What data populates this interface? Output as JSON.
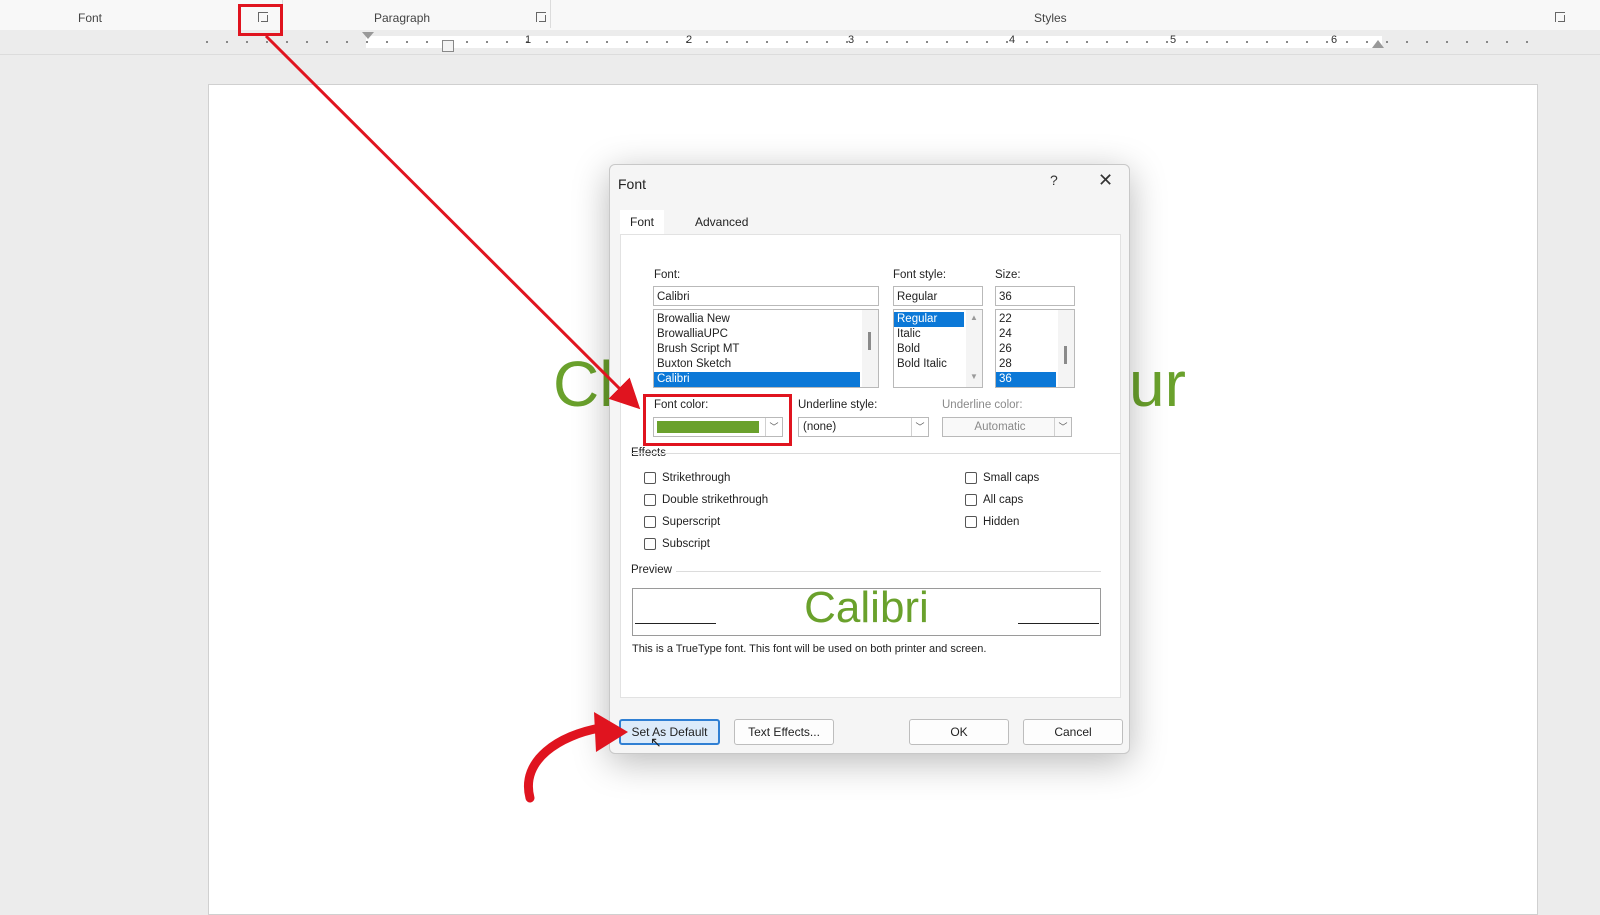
{
  "ribbon": {
    "groups": [
      {
        "label": "Font"
      },
      {
        "label": "Paragraph"
      },
      {
        "label": "Styles"
      }
    ]
  },
  "ruler": {
    "numbers": [
      "1",
      "2",
      "3",
      "4",
      "5",
      "6"
    ]
  },
  "document": {
    "text_left": "Cl",
    "text_right": "ur",
    "text_color": "#6aa12c"
  },
  "dialog": {
    "title": "Font",
    "help_glyph": "?",
    "close_glyph": "✕",
    "tabs": [
      {
        "label": "Font",
        "active": true
      },
      {
        "label": "Advanced",
        "active": false
      }
    ],
    "font": {
      "label": "Font:",
      "value": "Calibri",
      "list": [
        {
          "name": "Browallia New",
          "selected": false
        },
        {
          "name": "BrowalliaUPC",
          "selected": false
        },
        {
          "name": "Brush Script MT",
          "selected": false
        },
        {
          "name": "Buxton Sketch",
          "selected": false
        },
        {
          "name": "Calibri",
          "selected": true
        }
      ]
    },
    "font_style": {
      "label": "Font style:",
      "value": "Regular",
      "list": [
        {
          "name": "Regular",
          "selected": true
        },
        {
          "name": "Italic",
          "selected": false
        },
        {
          "name": "Bold",
          "selected": false
        },
        {
          "name": "Bold Italic",
          "selected": false
        }
      ]
    },
    "size": {
      "label": "Size:",
      "value": "36",
      "list": [
        {
          "name": "22",
          "selected": false
        },
        {
          "name": "24",
          "selected": false
        },
        {
          "name": "26",
          "selected": false
        },
        {
          "name": "28",
          "selected": false
        },
        {
          "name": "36",
          "selected": true
        }
      ]
    },
    "font_color": {
      "label": "Font color:",
      "color": "#6aa12c"
    },
    "underline_style": {
      "label": "Underline style:",
      "value": "(none)"
    },
    "underline_color": {
      "label": "Underline color:",
      "value": "Automatic",
      "disabled": true
    },
    "effects": {
      "label": "Effects",
      "left": [
        {
          "label": "Strikethrough",
          "checked": false
        },
        {
          "label": "Double strikethrough",
          "checked": false
        },
        {
          "label": "Superscript",
          "checked": false
        },
        {
          "label": "Subscript",
          "checked": false
        }
      ],
      "right": [
        {
          "label": "Small caps",
          "checked": false
        },
        {
          "label": "All caps",
          "checked": false
        },
        {
          "label": "Hidden",
          "checked": false
        }
      ]
    },
    "preview": {
      "label": "Preview",
      "sample": "Calibri",
      "note": "This is a TrueType font. This font will be used on both printer and screen."
    },
    "buttons": {
      "set_default": "Set As Default",
      "text_effects": "Text Effects...",
      "ok": "OK",
      "cancel": "Cancel"
    }
  },
  "annotations": {
    "highlight_color": "#e0141f",
    "arrow_color": "#e0141f"
  }
}
